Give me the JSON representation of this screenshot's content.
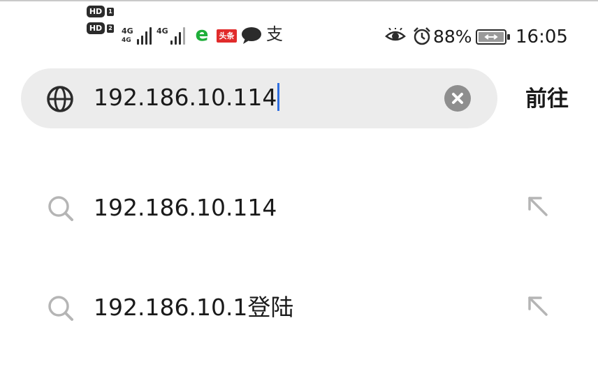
{
  "status_bar": {
    "sim1_label": "HD",
    "sim1_index": "1",
    "sim2_label": "HD",
    "sim2_index": "2",
    "signal1_type": "4G",
    "signal1_sub": "4G",
    "signal2_type": "4G",
    "signal1_bars": 4,
    "signal2_bars": 3,
    "notification_icons": [
      "browser-e-icon",
      "toutiao-icon",
      "chat-bubble-icon",
      "alipay-icon"
    ],
    "toutiao_label": "头条",
    "alipay_label": "支",
    "browser_label": "e",
    "battery_percent": "88%",
    "time": "16:05",
    "colors": {
      "browser": "#1fae3a",
      "toutiao": "#e12b2b"
    }
  },
  "search": {
    "value": "192.186.10.114",
    "go_label": "前往",
    "caret_color": "#2f6fe0",
    "background": "#ececec"
  },
  "suggestions": [
    {
      "text": "192.186.10.114",
      "icon": "search-icon",
      "action_icon": "arrow-up-left-icon"
    },
    {
      "text": "192.186.10.1登陆",
      "icon": "search-icon",
      "action_icon": "arrow-up-left-icon"
    }
  ]
}
